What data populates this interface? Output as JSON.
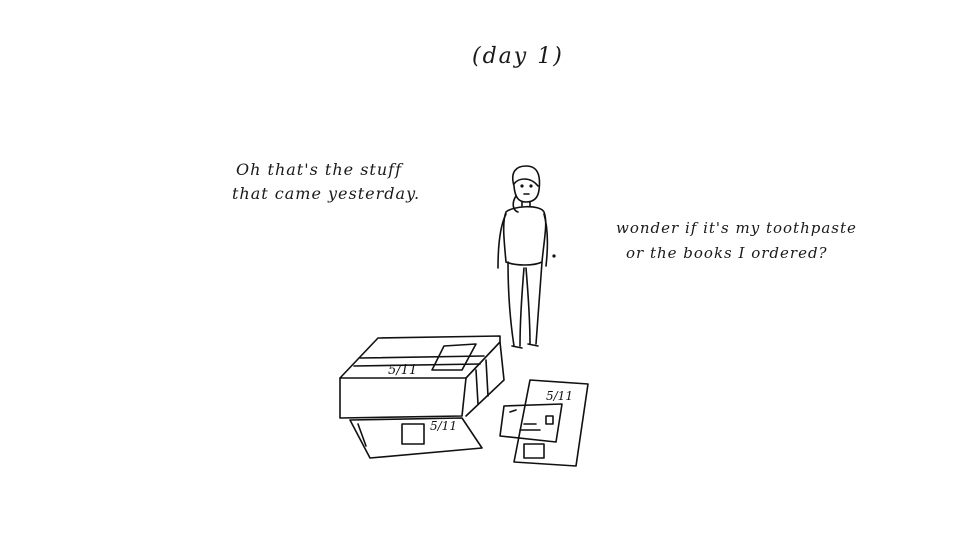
{
  "title": "(day 1)",
  "speech_left": {
    "line1": "Oh that's the stuff",
    "line2": "that came yesterday."
  },
  "speech_right": {
    "line1": "wonder if it's my toothpaste",
    "line2": "or the books I ordered?"
  },
  "labels": {
    "box_top": "5/11",
    "box_front": "5/11",
    "mailer": "5/11"
  }
}
